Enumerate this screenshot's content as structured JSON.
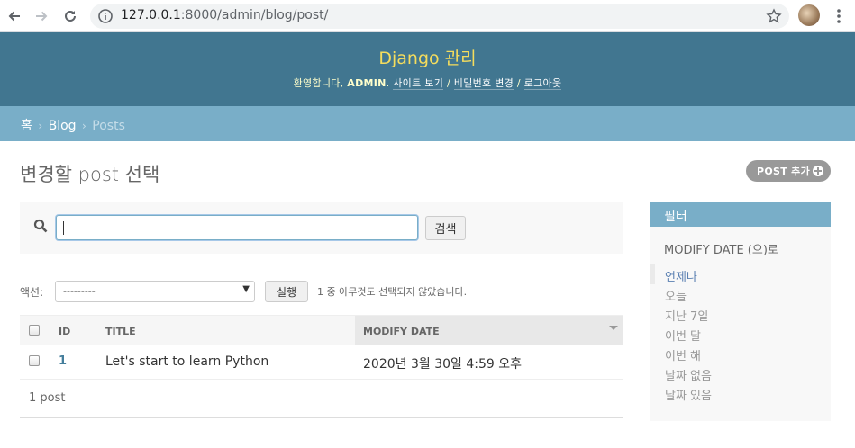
{
  "browser": {
    "url_host": "127.0.0.1",
    "url_rest": ":8000/admin/blog/post/"
  },
  "header": {
    "branding": "Django 관리",
    "welcome": "환영합니다,",
    "username": "ADMIN",
    "view_site": "사이트 보기",
    "change_password": "비밀번호 변경",
    "logout": "로그아웃",
    "sep": "/",
    "dot": "."
  },
  "breadcrumbs": {
    "home": "홈",
    "app": "Blog",
    "model": "Posts",
    "sep": "›"
  },
  "page": {
    "title": "변경할 post 선택",
    "add_button": "POST 추가"
  },
  "search": {
    "value": "",
    "button": "검색"
  },
  "actions": {
    "label": "액션:",
    "selected": "---------",
    "go": "실행",
    "counter": "1 중 아무것도 선택되지 않았습니다."
  },
  "table": {
    "columns": [
      "ID",
      "TITLE",
      "MODIFY DATE"
    ],
    "rows": [
      {
        "id": "1",
        "title": "Let's start to learn Python",
        "modify_date": "2020년 3월 30일 4:59 오후"
      }
    ],
    "paginator": "1 post"
  },
  "filter": {
    "heading": "필터",
    "title": "MODIFY DATE (으)로",
    "options": [
      "언제나",
      "오늘",
      "지난 7일",
      "이번 달",
      "이번 해",
      "날짜 없음",
      "날짜 있음"
    ],
    "selected_index": 0
  },
  "colors": {
    "header_bg": "#417690",
    "branding": "#f5dd5d",
    "breadcrumb_bg": "#79aec8",
    "link": "#447e9b"
  }
}
